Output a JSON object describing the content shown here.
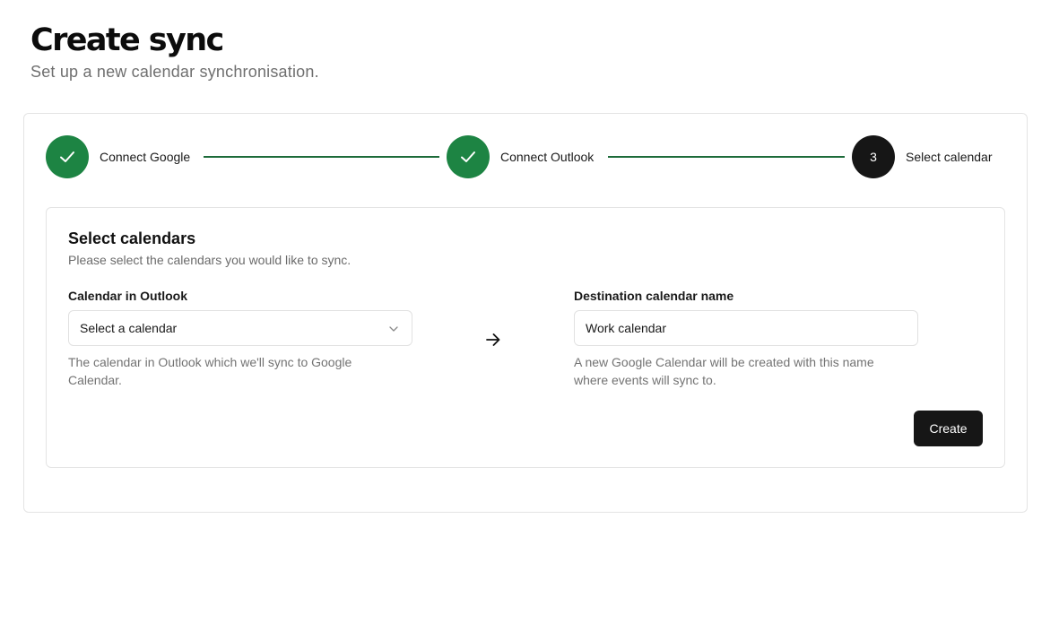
{
  "header": {
    "title": "Create sync",
    "subtitle": "Set up a new calendar synchronisation."
  },
  "stepper": {
    "steps": [
      {
        "label": "Connect Google",
        "status": "complete",
        "icon": "check-icon"
      },
      {
        "label": "Connect Outlook",
        "status": "complete",
        "icon": "check-icon"
      },
      {
        "label": "Select calendar",
        "status": "current",
        "number": "3"
      }
    ]
  },
  "form": {
    "title": "Select calendars",
    "description": "Please select the calendars you would like to sync.",
    "source": {
      "label": "Calendar in Outlook",
      "value": "Select a calendar",
      "help": "The calendar in Outlook which we'll sync to Google Calendar."
    },
    "destination": {
      "label": "Destination calendar name",
      "value": "Work calendar",
      "help": "A new Google Calendar will be created with this name where events will sync to."
    },
    "submit_label": "Create"
  },
  "colors": {
    "success": "#1d8443",
    "connector": "#1d6b3a",
    "primary_button": "#161616"
  }
}
